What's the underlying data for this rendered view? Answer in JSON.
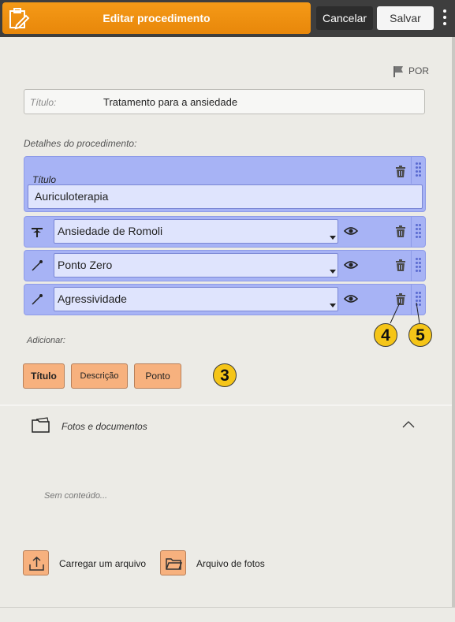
{
  "header": {
    "title": "Editar procedimento",
    "cancel_label": "Cancelar",
    "save_label": "Salvar",
    "colors": {
      "bar": "#3e3e3e",
      "accent": "#f59a17"
    }
  },
  "language": {
    "label": "POR"
  },
  "title_field": {
    "label": "Título:",
    "value": "Tratamento para a ansiedade"
  },
  "details": {
    "label": "Detalhes do procedimento:",
    "title_block": {
      "label": "Título",
      "value": "Auriculoterapia"
    },
    "rows": [
      {
        "icon": "acupuncture-point-icon",
        "value": "Ansiedade de Romoli"
      },
      {
        "icon": "needle-icon",
        "value": "Ponto Zero"
      },
      {
        "icon": "needle-icon",
        "value": "Agressividade"
      }
    ]
  },
  "add": {
    "label": "Adicionar:",
    "buttons": {
      "title": "Título",
      "description": "Descrição",
      "point": "Ponto"
    }
  },
  "callouts": {
    "c3": "3",
    "c4": "4",
    "c5": "5"
  },
  "photos": {
    "label": "Fotos e documentos",
    "empty": "Sem conteúdo...",
    "upload_label": "Carregar um arquivo",
    "archive_label": "Arquivo de fotos"
  }
}
